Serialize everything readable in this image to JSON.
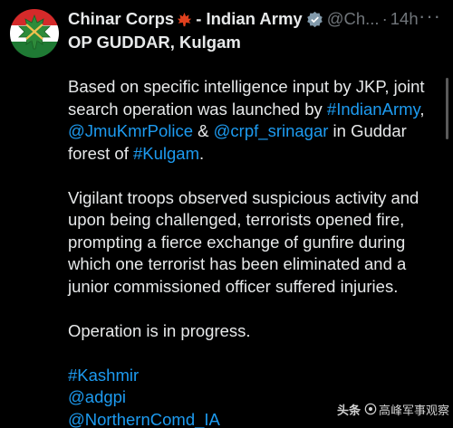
{
  "tweet": {
    "author": {
      "name": "Chinar Corps",
      "name_emoji": "maple-leaf-icon",
      "org": "- Indian Army",
      "verified_icon": "verified-badge-icon",
      "handle": "@Ch...",
      "separator": "·",
      "time": "14h",
      "avatar_icon": "chinar-leaf-emblem",
      "avatar_colors": {
        "top": "#d42a2a",
        "middle": "#ffffff",
        "bottom": "#1f7a34"
      }
    },
    "more_label": "···",
    "title": "OP GUDDAR, Kulgam",
    "paragraph1": {
      "line1": "Based on specific intelligence input by JKP, joint",
      "line2_text": "search operation was launched by ",
      "line2_link": "#IndianArmy",
      "line2_end": ",",
      "line3_link1": "@JmuKmrPolice",
      "line3_amp": " & ",
      "line3_link2": "@crpf_srinagar",
      "line3_text": " in Guddar",
      "line4_text": "forest of ",
      "line4_link": "#Kulgam",
      "line4_end": "."
    },
    "paragraph2": {
      "line1": "Vigilant troops observed suspicious activity and",
      "line2": "upon being challenged, terrorists opened fire,",
      "line3": "prompting a fierce exchange of gunfire during",
      "line4": "which one terrorist has been eliminated and a",
      "line5": "junior commissioned officer suffered injuries."
    },
    "paragraph3": "Operation is in progress.",
    "tags": [
      "#Kashmir",
      "@adgpi",
      "@NorthernComd_IA"
    ]
  },
  "watermark": {
    "logo": "头条",
    "text": "高峰军事观察"
  },
  "colors": {
    "background": "#000000",
    "text": "#e7e9ea",
    "link": "#1d9bf0",
    "muted": "#71767b"
  }
}
